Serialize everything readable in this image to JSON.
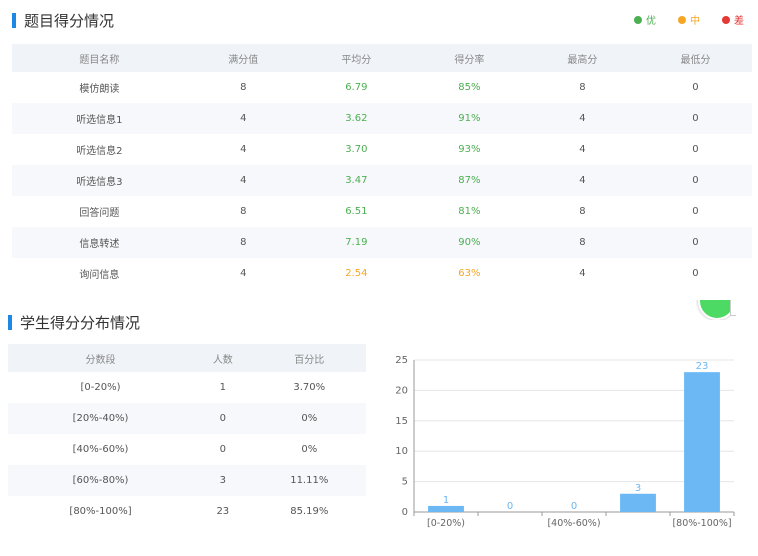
{
  "section1": {
    "title": "题目得分情况"
  },
  "legend": [
    {
      "label": "优",
      "color": "#4caf50"
    },
    {
      "label": "中",
      "color": "#f5a623"
    },
    {
      "label": "差",
      "color": "#e53935"
    }
  ],
  "score_table": {
    "headers": [
      "题目名称",
      "满分值",
      "平均分",
      "得分率",
      "最高分",
      "最低分"
    ],
    "rows": [
      {
        "name": "模仿朗读",
        "full": "8",
        "avg": "6.79",
        "rate": "85%",
        "max": "8",
        "min": "0",
        "level": "good"
      },
      {
        "name": "听选信息1",
        "full": "4",
        "avg": "3.62",
        "rate": "91%",
        "max": "4",
        "min": "0",
        "level": "good"
      },
      {
        "name": "听选信息2",
        "full": "4",
        "avg": "3.70",
        "rate": "93%",
        "max": "4",
        "min": "0",
        "level": "good"
      },
      {
        "name": "听选信息3",
        "full": "4",
        "avg": "3.47",
        "rate": "87%",
        "max": "4",
        "min": "0",
        "level": "good"
      },
      {
        "name": "回答问题",
        "full": "8",
        "avg": "6.51",
        "rate": "81%",
        "max": "8",
        "min": "0",
        "level": "good"
      },
      {
        "name": "信息转述",
        "full": "8",
        "avg": "7.19",
        "rate": "90%",
        "max": "8",
        "min": "0",
        "level": "good"
      },
      {
        "name": "询问信息",
        "full": "4",
        "avg": "2.54",
        "rate": "63%",
        "max": "4",
        "min": "0",
        "level": "mid"
      }
    ]
  },
  "section2": {
    "title": "学生得分分布情况"
  },
  "dist_table": {
    "headers": [
      "分数段",
      "人数",
      "百分比"
    ],
    "rows": [
      {
        "range": "[0-20%)",
        "count": "1",
        "pct": "3.70%"
      },
      {
        "range": "[20%-40%)",
        "count": "0",
        "pct": "0%"
      },
      {
        "range": "[40%-60%)",
        "count": "0",
        "pct": "0%"
      },
      {
        "range": "[60%-80%)",
        "count": "3",
        "pct": "11.11%"
      },
      {
        "range": "[80%-100%]",
        "count": "23",
        "pct": "85.19%"
      }
    ]
  },
  "chart_data": {
    "type": "bar",
    "categories": [
      "[0-20%)",
      "[20%-40%)",
      "[40%-60%)",
      "[60%-80%)",
      "[80%-100%]"
    ],
    "tick_labels_shown": [
      "[0-20%)",
      "",
      "[40%-60%)",
      "",
      "[80%-100%]"
    ],
    "values": [
      1,
      0,
      0,
      3,
      23
    ],
    "ylim": [
      0,
      25
    ],
    "yticks": [
      0,
      5,
      10,
      15,
      20,
      25
    ],
    "grid": true,
    "bar_color": "#6bb8f5",
    "label_color": "#6bb8f5"
  }
}
